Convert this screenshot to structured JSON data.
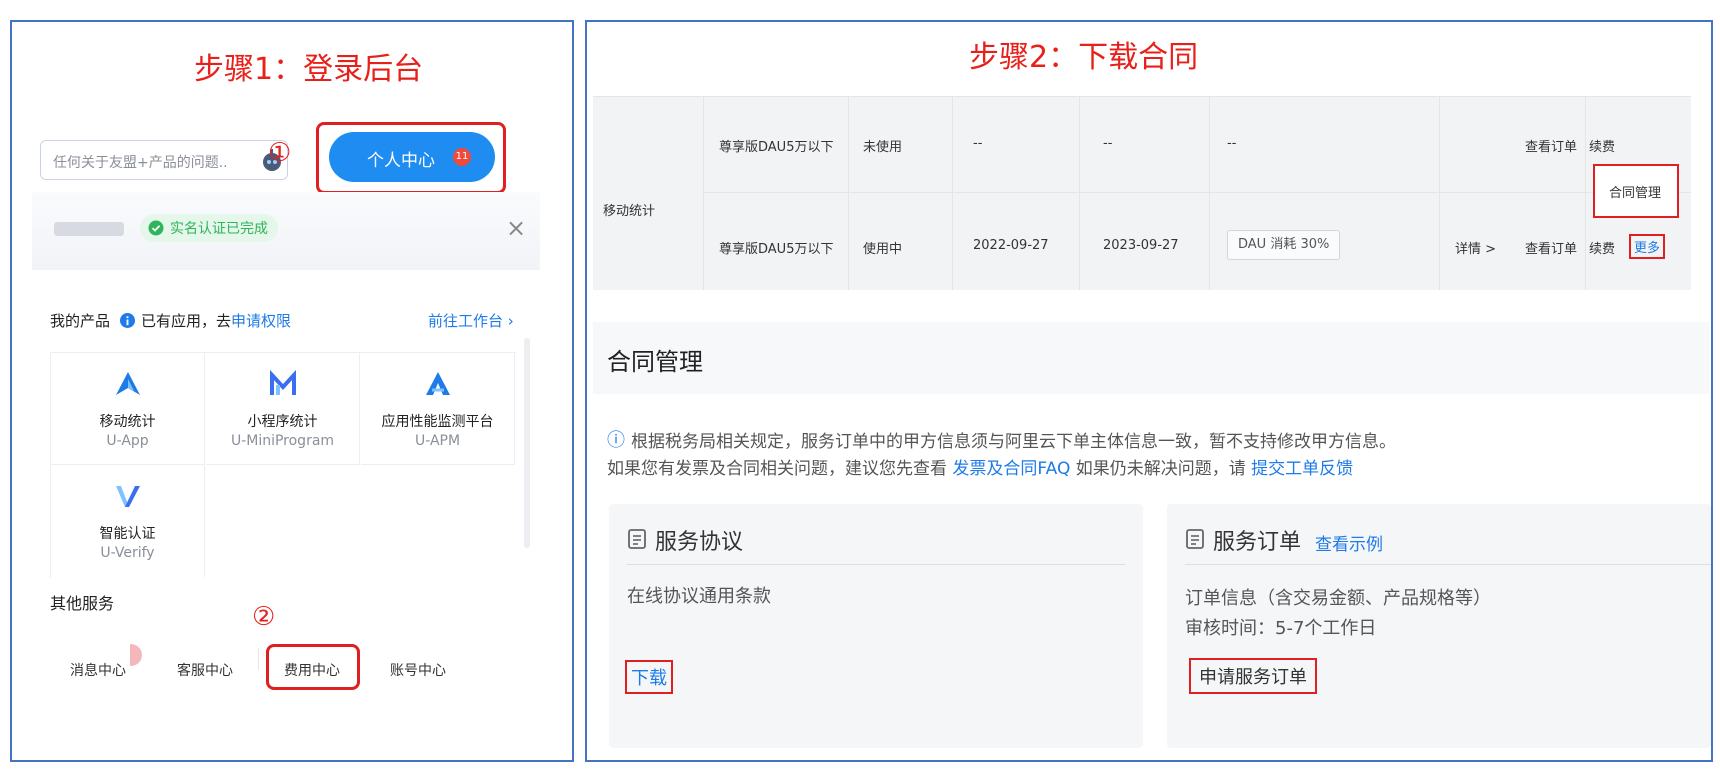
{
  "step1": {
    "title": "步骤1：登录后台",
    "search_placeholder": "任何关于友盟+产品的问题..",
    "circle_1": "①",
    "personal_center_label": "个人中心",
    "personal_center_badge": "11",
    "verify_badge": "实名认证已完成",
    "close_symbol": "×",
    "my_products_label": "我的产品",
    "applied_text": "已有应用，去",
    "apply_perm_link": "申请权限",
    "goto_workbench": "前往工作台 ›",
    "products": [
      {
        "name": "移动统计",
        "sub": "U-App",
        "icon": "u-app-icon",
        "color": "#1e7be8"
      },
      {
        "name": "小程序统计",
        "sub": "U-MiniProgram",
        "icon": "u-miniprogram-icon",
        "color": "#3b6ff0"
      },
      {
        "name": "应用性能监测平台",
        "sub": "U-APM",
        "icon": "u-apm-icon",
        "color": "#1e7be8"
      },
      {
        "name": "智能认证",
        "sub": "U-Verify",
        "icon": "u-verify-icon",
        "color": "#3b6ff0"
      }
    ],
    "other_services_label": "其他服务",
    "circle_2": "②",
    "services": [
      "消息中心",
      "客服中心",
      "费用中心",
      "账号中心"
    ]
  },
  "step2": {
    "title": "步骤2：下载合同",
    "table": {
      "group_label": "移动统计",
      "rows": [
        {
          "edition": "尊享版DAU5万以下",
          "status": "未使用",
          "start": "--",
          "end": "--",
          "usage": "--",
          "actions": [
            "查看订单",
            "续费"
          ]
        },
        {
          "edition": "尊享版DAU5万以下",
          "status": "使用中",
          "start": "2022-09-27",
          "end": "2023-09-27",
          "usage": "DAU 消耗 30%",
          "detail": "详情 >",
          "actions": [
            "查看订单",
            "续费",
            "更多"
          ]
        }
      ],
      "popup_item": "合同管理"
    },
    "contract_title": "合同管理",
    "notice_icon": "ⓘ",
    "notice_line1": "根据税务局相关规定，服务订单中的甲方信息须与阿里云下单主体信息一致，暂不支持修改甲方信息。",
    "notice_line2_prefix": "如果您有发票及合同相关问题，建议您先查看",
    "notice_link1": "发票及合同FAQ",
    "notice_line2_mid": "如果仍未解决问题，请",
    "notice_link2": "提交工单反馈",
    "card1": {
      "title": "服务协议",
      "text": "在线协议通用条款",
      "action": "下载"
    },
    "card2": {
      "title": "服务订单",
      "example_link": "查看示例",
      "text1": "订单信息（含交易金额、产品规格等）",
      "text2": "审核时间：5-7个工作日",
      "action": "申请服务订单"
    }
  },
  "colors": {
    "accent": "#1e7be8",
    "highlight": "#e02020",
    "frame": "#4472c4",
    "verified": "#2fb55a"
  }
}
